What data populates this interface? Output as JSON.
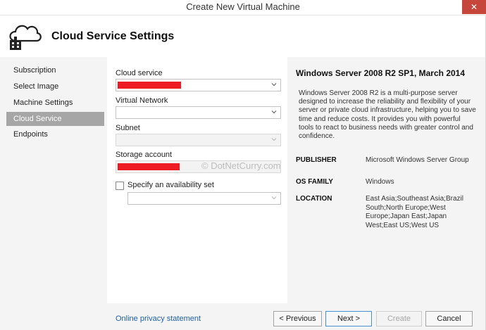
{
  "window": {
    "title": "Create New Virtual Machine",
    "close_glyph": "✕"
  },
  "header": {
    "title": "Cloud Service Settings"
  },
  "nav": {
    "items": [
      {
        "label": "Subscription"
      },
      {
        "label": "Select Image"
      },
      {
        "label": "Machine Settings"
      },
      {
        "label": "Cloud Service"
      },
      {
        "label": "Endpoints"
      }
    ],
    "active_index": 3
  },
  "form": {
    "cloud_service_label": "Cloud service",
    "virtual_network_label": "Virtual Network",
    "subnet_label": "Subnet",
    "storage_account_label": "Storage account",
    "availability_set_label": "Specify an availability set",
    "redaction_color": "#ee1b24"
  },
  "watermark": "© DotNetCurry.com",
  "details": {
    "title": "Windows Server 2008 R2 SP1, March 2014",
    "description": "Windows Server 2008 R2 is a multi-purpose server designed to increase the reliability and flexibility of your server or private cloud infrastructure, helping you to save time and reduce costs.  It provides you with powerful tools to react to business needs with greater control and confidence.",
    "properties": [
      {
        "label": "PUBLISHER",
        "value": "Microsoft Windows Server Group"
      },
      {
        "label": "OS FAMILY",
        "value": "Windows"
      },
      {
        "label": "LOCATION",
        "value": "East Asia;Southeast Asia;Brazil South;North Europe;West Europe;Japan East;Japan West;East US;West US"
      }
    ]
  },
  "footer": {
    "privacy_link": "Online privacy statement",
    "previous_label": "< Previous",
    "next_label": "Next >",
    "create_label": "Create",
    "cancel_label": "Cancel"
  },
  "colors": {
    "active_nav": "#a6a6a6",
    "link": "#1f5fa8",
    "close_button": "#c7463b"
  }
}
